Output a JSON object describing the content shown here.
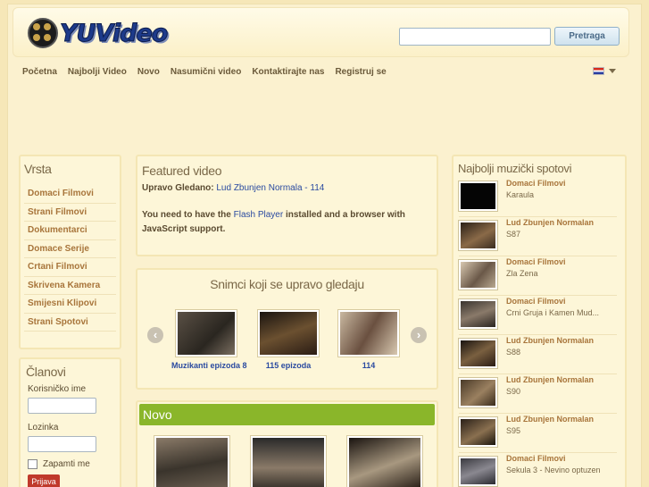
{
  "header": {
    "logo_text": "YUVideo",
    "search_placeholder": "",
    "search_button": "Pretraga"
  },
  "nav": {
    "items": [
      "Početna",
      "Najbolji Video",
      "Novo",
      "Nasumični video",
      "Kontaktirajte nas",
      "Registruj se"
    ]
  },
  "sidebar": {
    "categories_title": "Vrsta",
    "categories": [
      "Domaci Filmovi",
      "Strani Filmovi",
      "Dokumentarci",
      "Domace Serije",
      "Crtani Filmovi",
      "Skrivena Kamera",
      "Smijesni Klipovi",
      "Strani Spotovi"
    ],
    "members_title": "Članovi",
    "username_label": "Korisničko ime",
    "password_label": "Lozinka",
    "remember_label": "Zapamti me",
    "login_button": "Prijava"
  },
  "featured": {
    "title": "Featured video",
    "now_watching_label": "Upravo Gledano:",
    "now_watching_value": "Lud Zbunjen Normala - 114",
    "flash_text_1": "You need to have the ",
    "flash_link": "Flash Player",
    "flash_text_2": " installed and a browser with JavaScript support."
  },
  "watching": {
    "title": "Snimci koji se upravo gledaju",
    "items": [
      {
        "caption": "Muzikanti epizoda 8"
      },
      {
        "caption": "115 epizoda"
      },
      {
        "caption": "114"
      }
    ]
  },
  "novo": {
    "title": "Novo"
  },
  "spots": {
    "title": "Najbolji muzički spotovi",
    "items": [
      {
        "title": "Domaci Filmovi",
        "sub": "Karaula"
      },
      {
        "title": "Lud Zbunjen Normalan",
        "sub": "S87"
      },
      {
        "title": "Domaci Filmovi",
        "sub": "Zla Zena"
      },
      {
        "title": "Domaci Filmovi",
        "sub": "Crni Gruja i Kamen Mud..."
      },
      {
        "title": "Lud Zbunjen Normalan",
        "sub": "S88"
      },
      {
        "title": "Lud Zbunjen Normalan",
        "sub": "S90"
      },
      {
        "title": "Lud Zbunjen Normalan",
        "sub": "S95"
      },
      {
        "title": "Domaci Filmovi",
        "sub": "Sekula 3 - Nevino optuzen"
      }
    ]
  },
  "colors": {
    "accent_green": "#8ab62a",
    "link_blue": "#2a4aa0",
    "category_brown": "#a8753b",
    "login_red": "#c0392b"
  }
}
